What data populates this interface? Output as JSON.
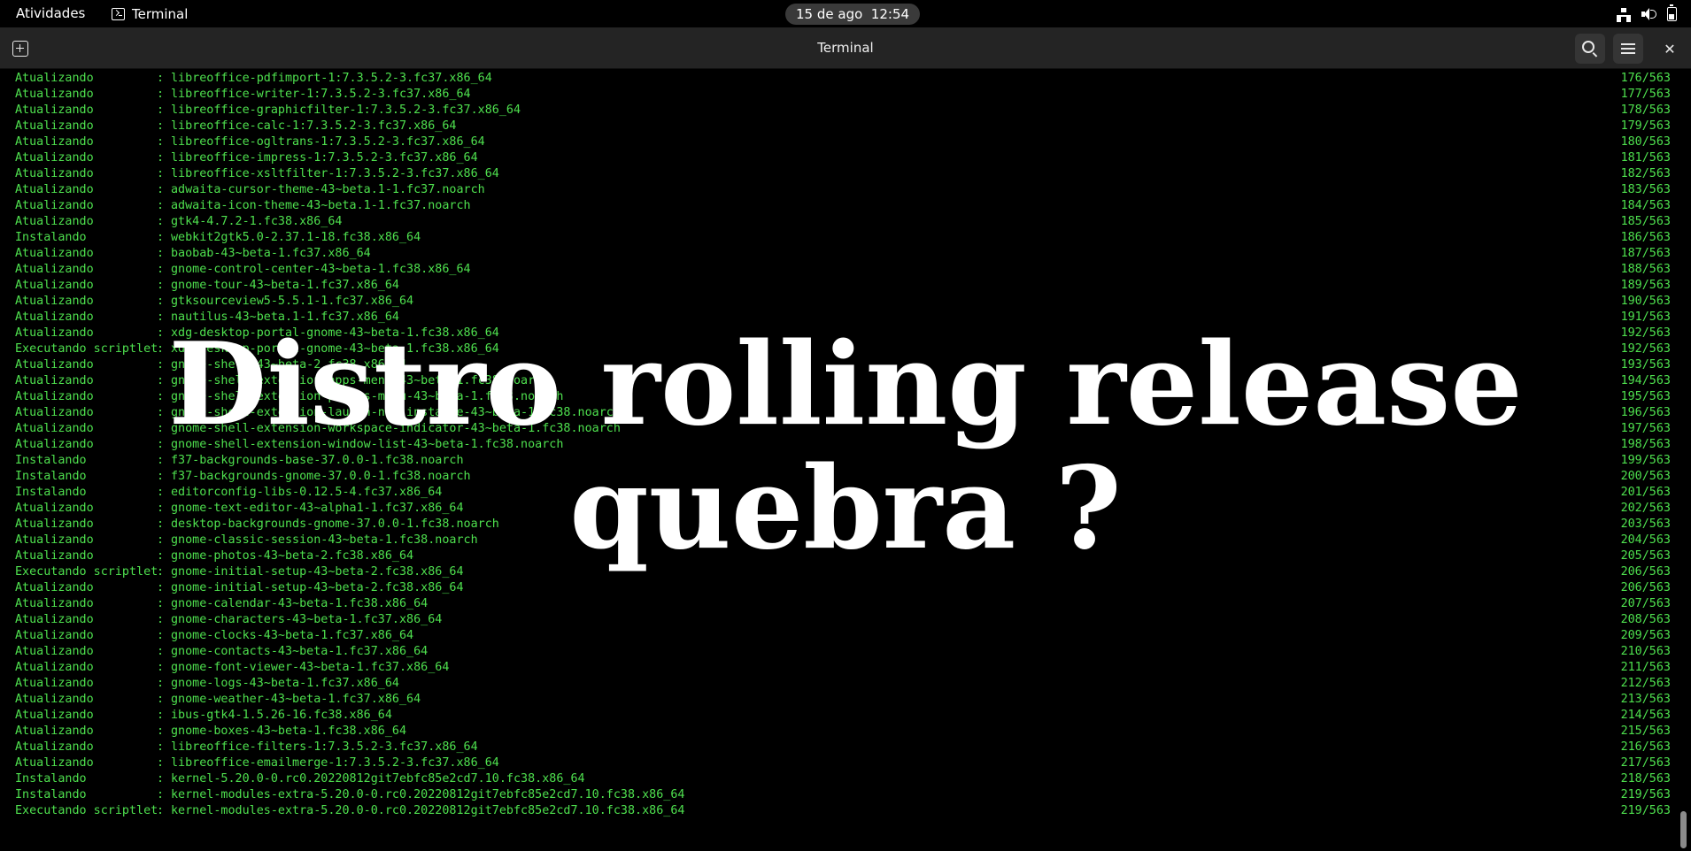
{
  "topbar": {
    "activities": "Atividades",
    "app_name": "Terminal",
    "clock": "15 de ago  12:54",
    "tray_icons": [
      "network-wired-icon",
      "volume-icon",
      "battery-icon"
    ]
  },
  "window": {
    "title": "Terminal"
  },
  "terminal_lines": [
    {
      "action": "Atualizando",
      "package": "libreoffice-pdfimport-1:7.3.5.2-3.fc37.x86_64",
      "count": "176/563"
    },
    {
      "action": "Atualizando",
      "package": "libreoffice-writer-1:7.3.5.2-3.fc37.x86_64",
      "count": "177/563"
    },
    {
      "action": "Atualizando",
      "package": "libreoffice-graphicfilter-1:7.3.5.2-3.fc37.x86_64",
      "count": "178/563"
    },
    {
      "action": "Atualizando",
      "package": "libreoffice-calc-1:7.3.5.2-3.fc37.x86_64",
      "count": "179/563"
    },
    {
      "action": "Atualizando",
      "package": "libreoffice-ogltrans-1:7.3.5.2-3.fc37.x86_64",
      "count": "180/563"
    },
    {
      "action": "Atualizando",
      "package": "libreoffice-impress-1:7.3.5.2-3.fc37.x86_64",
      "count": "181/563"
    },
    {
      "action": "Atualizando",
      "package": "libreoffice-xsltfilter-1:7.3.5.2-3.fc37.x86_64",
      "count": "182/563"
    },
    {
      "action": "Atualizando",
      "package": "adwaita-cursor-theme-43~beta.1-1.fc37.noarch",
      "count": "183/563"
    },
    {
      "action": "Atualizando",
      "package": "adwaita-icon-theme-43~beta.1-1.fc37.noarch",
      "count": "184/563"
    },
    {
      "action": "Atualizando",
      "package": "gtk4-4.7.2-1.fc38.x86_64",
      "count": "185/563"
    },
    {
      "action": "Instalando",
      "package": "webkit2gtk5.0-2.37.1-18.fc38.x86_64",
      "count": "186/563"
    },
    {
      "action": "Atualizando",
      "package": "baobab-43~beta-1.fc37.x86_64",
      "count": "187/563"
    },
    {
      "action": "Atualizando",
      "package": "gnome-control-center-43~beta-1.fc38.x86_64",
      "count": "188/563"
    },
    {
      "action": "Atualizando",
      "package": "gnome-tour-43~beta-1.fc37.x86_64",
      "count": "189/563"
    },
    {
      "action": "Atualizando",
      "package": "gtksourceview5-5.5.1-1.fc37.x86_64",
      "count": "190/563"
    },
    {
      "action": "Atualizando",
      "package": "nautilus-43~beta.1-1.fc37.x86_64",
      "count": "191/563"
    },
    {
      "action": "Atualizando",
      "package": "xdg-desktop-portal-gnome-43~beta-1.fc38.x86_64",
      "count": "192/563"
    },
    {
      "action": "Executando scriptlet",
      "package": "xdg-desktop-portal-gnome-43~beta-1.fc38.x86_64",
      "count": "192/563"
    },
    {
      "action": "Atualizando",
      "package": "gnome-shell-43~beta-2.fc38.x86_64",
      "count": "193/563"
    },
    {
      "action": "Atualizando",
      "package": "gnome-shell-extension-apps-menu-43~beta-1.fc38.noarch",
      "count": "194/563"
    },
    {
      "action": "Atualizando",
      "package": "gnome-shell-extension-places-menu-43~beta-1.fc38.noarch",
      "count": "195/563"
    },
    {
      "action": "Atualizando",
      "package": "gnome-shell-extension-launch-new-instance-43~beta-1.fc38.noarch",
      "count": "196/563"
    },
    {
      "action": "Atualizando",
      "package": "gnome-shell-extension-workspace-indicator-43~beta-1.fc38.noarch",
      "count": "197/563"
    },
    {
      "action": "Atualizando",
      "package": "gnome-shell-extension-window-list-43~beta-1.fc38.noarch",
      "count": "198/563"
    },
    {
      "action": "Instalando",
      "package": "f37-backgrounds-base-37.0.0-1.fc38.noarch",
      "count": "199/563"
    },
    {
      "action": "Instalando",
      "package": "f37-backgrounds-gnome-37.0.0-1.fc38.noarch",
      "count": "200/563"
    },
    {
      "action": "Instalando",
      "package": "editorconfig-libs-0.12.5-4.fc37.x86_64",
      "count": "201/563"
    },
    {
      "action": "Atualizando",
      "package": "gnome-text-editor-43~alpha1-1.fc37.x86_64",
      "count": "202/563"
    },
    {
      "action": "Atualizando",
      "package": "desktop-backgrounds-gnome-37.0.0-1.fc38.noarch",
      "count": "203/563"
    },
    {
      "action": "Atualizando",
      "package": "gnome-classic-session-43~beta-1.fc38.noarch",
      "count": "204/563"
    },
    {
      "action": "Atualizando",
      "package": "gnome-photos-43~beta-2.fc38.x86_64",
      "count": "205/563"
    },
    {
      "action": "Executando scriptlet",
      "package": "gnome-initial-setup-43~beta-2.fc38.x86_64",
      "count": "206/563"
    },
    {
      "action": "Atualizando",
      "package": "gnome-initial-setup-43~beta-2.fc38.x86_64",
      "count": "206/563"
    },
    {
      "action": "Atualizando",
      "package": "gnome-calendar-43~beta-1.fc38.x86_64",
      "count": "207/563"
    },
    {
      "action": "Atualizando",
      "package": "gnome-characters-43~beta-1.fc37.x86_64",
      "count": "208/563"
    },
    {
      "action": "Atualizando",
      "package": "gnome-clocks-43~beta-1.fc37.x86_64",
      "count": "209/563"
    },
    {
      "action": "Atualizando",
      "package": "gnome-contacts-43~beta-1.fc37.x86_64",
      "count": "210/563"
    },
    {
      "action": "Atualizando",
      "package": "gnome-font-viewer-43~beta-1.fc37.x86_64",
      "count": "211/563"
    },
    {
      "action": "Atualizando",
      "package": "gnome-logs-43~beta-1.fc37.x86_64",
      "count": "212/563"
    },
    {
      "action": "Atualizando",
      "package": "gnome-weather-43~beta-1.fc37.x86_64",
      "count": "213/563"
    },
    {
      "action": "Atualizando",
      "package": "ibus-gtk4-1.5.26-16.fc38.x86_64",
      "count": "214/563"
    },
    {
      "action": "Atualizando",
      "package": "gnome-boxes-43~beta-1.fc38.x86_64",
      "count": "215/563"
    },
    {
      "action": "Atualizando",
      "package": "libreoffice-filters-1:7.3.5.2-3.fc37.x86_64",
      "count": "216/563"
    },
    {
      "action": "Atualizando",
      "package": "libreoffice-emailmerge-1:7.3.5.2-3.fc37.x86_64",
      "count": "217/563"
    },
    {
      "action": "Instalando",
      "package": "kernel-5.20.0-0.rc0.20220812git7ebfc85e2cd7.10.fc38.x86_64",
      "count": "218/563"
    },
    {
      "action": "Instalando",
      "package": "kernel-modules-extra-5.20.0-0.rc0.20220812git7ebfc85e2cd7.10.fc38.x86_64",
      "count": "219/563"
    },
    {
      "action": "Executando scriptlet",
      "package": "kernel-modules-extra-5.20.0-0.rc0.20220812git7ebfc85e2cd7.10.fc38.x86_64",
      "count": "219/563"
    }
  ],
  "overlay": {
    "line1": "Distro rolling release",
    "line2": "quebra ?"
  },
  "colors": {
    "terminal_text": "#4ee04e",
    "terminal_bg": "#000000",
    "headerbar_bg": "#242424",
    "overlay_text": "#ffffff"
  }
}
